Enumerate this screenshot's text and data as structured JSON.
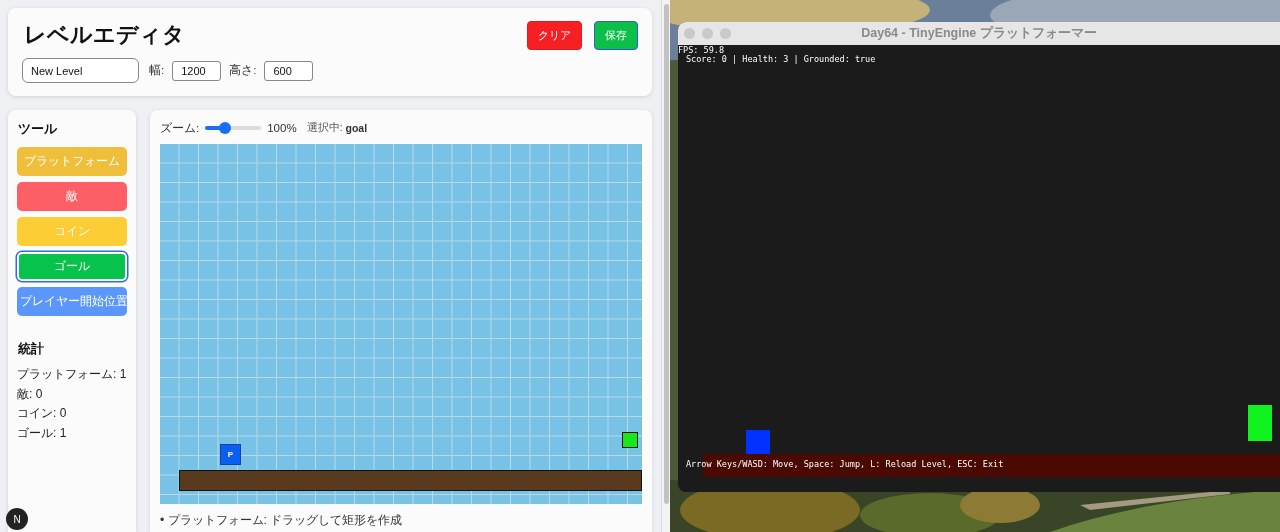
{
  "editor": {
    "title": "レベルエディタ",
    "buttons": [
      {
        "label": "クリア",
        "kind": "danger"
      },
      {
        "label": "保存",
        "kind": "primary"
      }
    ],
    "level_name": {
      "value": "New Level"
    },
    "width": {
      "label": "幅:",
      "value": "1200"
    },
    "height": {
      "label": "高さ:",
      "value": "600"
    },
    "tools": {
      "title": "ツール",
      "items": [
        {
          "label": "プラットフォーム",
          "color": "#efbf3c",
          "selected": false
        },
        {
          "label": "敵",
          "color": "#fe5f66",
          "selected": false
        },
        {
          "label": "コイン",
          "color": "#fdcd35",
          "selected": false
        },
        {
          "label": "ゴール",
          "color": "#07c24b",
          "selected": true
        },
        {
          "label": "プレイヤー開始位置",
          "color": "#5b97fb",
          "selected": false
        }
      ]
    },
    "stats": {
      "title": "統計",
      "items": [
        "プラットフォーム: 1",
        "敵: 0",
        "コイン: 0",
        "ゴール: 1"
      ]
    },
    "zoom": {
      "label": "ズーム:",
      "level": 0.35,
      "reading": "100%"
    },
    "selection": {
      "label": "選択中:",
      "value": "goal"
    },
    "objects": [
      {
        "kind": "platform"
      },
      {
        "kind": "player",
        "label": "P"
      },
      {
        "kind": "goal"
      }
    ],
    "help": [
      "• プラットフォーム: ドラッグして矩形を作成"
    ]
  },
  "game_window": {
    "title": "Day64 - TinyEngine プラットフォーマー",
    "fps": "FPS: 59.8",
    "status": "Score: 0 | Health: 3 | Grounded: true",
    "controls": "Arrow Keys/WASD: Move, Space: Jump, L: Reload Level, ESC: Exit"
  },
  "dev_badge": {
    "label": "N"
  }
}
